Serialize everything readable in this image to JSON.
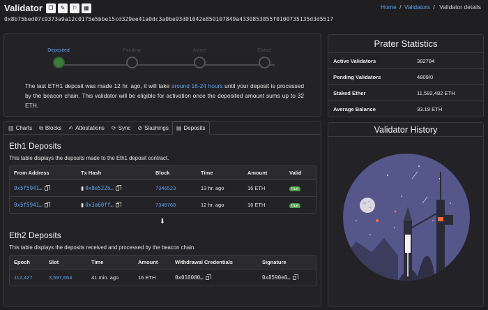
{
  "header": {
    "title": "Validator",
    "pubkey": "0x8b75bed07c9373a9a12c0175e5bbe15cd329ee41a0dc3a0be93d01042e850107849a4330853855f0100735135d3d5517",
    "breadcrumb": {
      "home": "Home",
      "sep1": "/",
      "validators": "Validators",
      "sep2": "/",
      "current": "Validator details"
    }
  },
  "status": {
    "steps": [
      {
        "label": "Deposited",
        "state": "done"
      },
      {
        "label": "Pending",
        "state": "todo"
      },
      {
        "label": "Active",
        "state": "todo"
      },
      {
        "label": "Exited",
        "state": "todo"
      }
    ],
    "message_pre": "The last ETH1 deposit was made 12 hr. ago, it will take ",
    "message_link": "around 16-24 hours",
    "message_post": " until your deposit is processed by the beacon chain. This validator will be eligible for activation once the deposited amount sums up to 32 ETH."
  },
  "stats": {
    "title": "Prater Statistics",
    "rows": [
      {
        "label": "Active Validators",
        "value": "382784"
      },
      {
        "label": "Pending Validators",
        "value": "4809/0"
      },
      {
        "label": "Staked Ether",
        "value": "11,592,482 ETH"
      },
      {
        "label": "Average Balance",
        "value": "33.19 ETH"
      }
    ]
  },
  "tabs": [
    {
      "label": "Charts",
      "icon": "chart-icon"
    },
    {
      "label": "Blocks",
      "icon": "cubes-icon"
    },
    {
      "label": "Attestations",
      "icon": "file-signature-icon"
    },
    {
      "label": "Sync",
      "icon": "sync-icon"
    },
    {
      "label": "Slashings",
      "icon": "slash-icon"
    },
    {
      "label": "Deposits",
      "icon": "wallet-icon"
    }
  ],
  "eth1": {
    "title": "Eth1 Deposits",
    "desc": "This table displays the deposits made to the Eth1 deposit contract.",
    "columns": [
      "From Address",
      "Tx Hash",
      "Block",
      "Time",
      "Amount",
      "Valid"
    ],
    "rows": [
      {
        "from": "0x5f5941…",
        "tx": "0x8e522b…",
        "block": "7346523",
        "time": "13 hr. ago",
        "amount": "16 ETH",
        "valid": "true"
      },
      {
        "from": "0x5f5941…",
        "tx": "0x3a60ff…",
        "block": "7346768",
        "time": "12 hr. ago",
        "amount": "16 ETH",
        "valid": "true"
      }
    ]
  },
  "eth2": {
    "title": "Eth2 Deposits",
    "desc": "This table displays the deposits received and processed by the beacon chain.",
    "columns": [
      "Epoch",
      "Slot",
      "Time",
      "Amount",
      "Withdrawal Credentials",
      "Signature"
    ],
    "rows": [
      {
        "epoch": "112,427",
        "slot": "3,597,664",
        "time": "41 min. ago",
        "amount": "16 ETH",
        "withdrawal": "0x010000…",
        "signature": "0x8590e8…"
      }
    ]
  },
  "history": {
    "title": "Validator History"
  },
  "colors": {
    "accent": "#5aa0e6",
    "success": "#3f7b3c",
    "badge": "#4e9d4d",
    "background": "#1f1e21",
    "panel": "#232226"
  }
}
